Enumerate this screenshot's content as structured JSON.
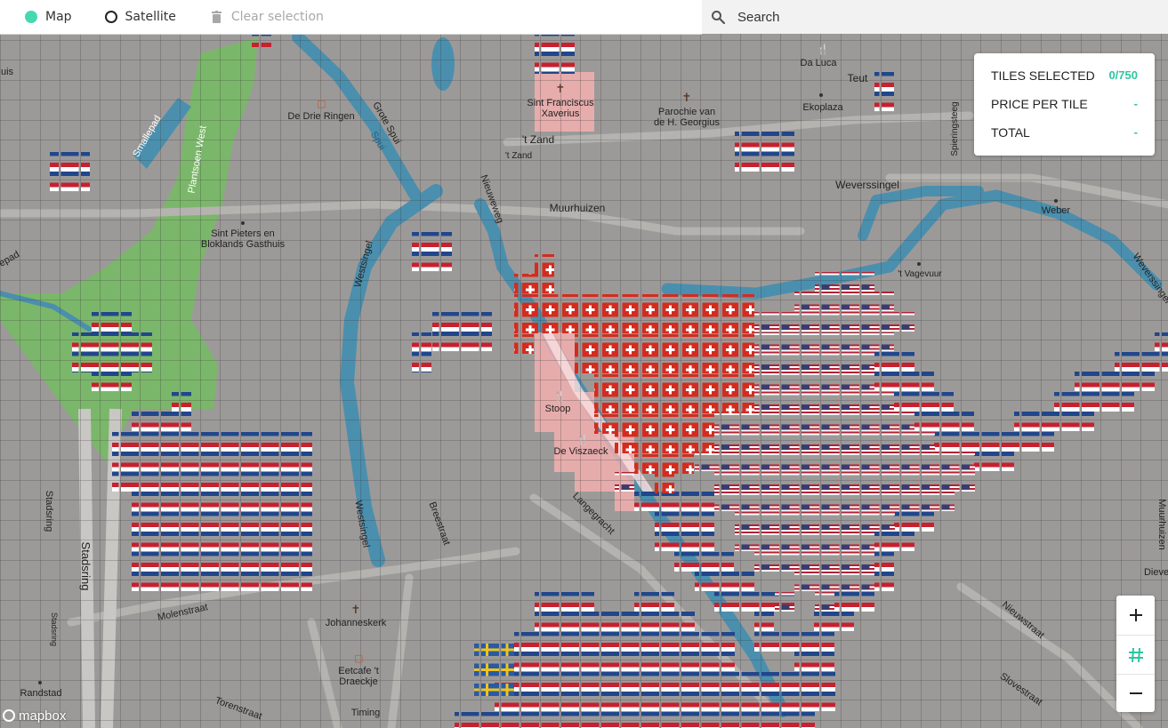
{
  "toolbar": {
    "map_label": "Map",
    "satellite_label": "Satellite",
    "clear_label": "Clear selection",
    "active_mode": "Map"
  },
  "search": {
    "placeholder": "Search"
  },
  "stats": {
    "tiles_selected_label": "TILES SELECTED",
    "tiles_selected_value": "0/750",
    "price_label": "PRICE PER TILE",
    "price_value": "-",
    "total_label": "TOTAL",
    "total_value": "-"
  },
  "zoom_controls": {
    "zoom_in": "+",
    "grid_toggle": "#",
    "zoom_out": "−"
  },
  "attribution": "mapbox",
  "colors": {
    "accent": "#45d9b0",
    "water": "#4b8fae",
    "park": "#7bb76a",
    "land": "#9b9a98",
    "selection": "#ffb3b3"
  },
  "map_labels": [
    {
      "text": "Da Luca"
    },
    {
      "text": "Teut"
    },
    {
      "text": "Ekoplaza"
    },
    {
      "text": "Sint Franciscus"
    },
    {
      "text": "Xaverius"
    },
    {
      "text": "Parochie van"
    },
    {
      "text": "de H. Georgius"
    },
    {
      "text": "De Drie Ringen"
    },
    {
      "text": "Grote Spui"
    },
    {
      "text": "Spui"
    },
    {
      "text": "'t Zand"
    },
    {
      "text": "'t Zand"
    },
    {
      "text": "Nieuweweg"
    },
    {
      "text": "Muurhuizen"
    },
    {
      "text": "Weverssingel"
    },
    {
      "text": "Weber"
    },
    {
      "text": "Spieringsteeg"
    },
    {
      "text": "Smallepad"
    },
    {
      "text": "Plantsoen West"
    },
    {
      "text": "Sint Pieters en"
    },
    {
      "text": "Bloklands Gasthuis"
    },
    {
      "text": "Westsingel"
    },
    {
      "text": "'t Vagevuur"
    },
    {
      "text": "Weverssingel"
    },
    {
      "text": "Stoop"
    },
    {
      "text": "De Viszaeck"
    },
    {
      "text": "Langegracht"
    },
    {
      "text": "Breestraat"
    },
    {
      "text": "Westsingel"
    },
    {
      "text": "Stadsring"
    },
    {
      "text": "Stadsring"
    },
    {
      "text": "Stadsring"
    },
    {
      "text": "Molenstraat"
    },
    {
      "text": "Johanneskerk"
    },
    {
      "text": "Eetcafe 't"
    },
    {
      "text": "Draeckje"
    },
    {
      "text": "Timing"
    },
    {
      "text": "Randstad"
    },
    {
      "text": "Torenstraat"
    },
    {
      "text": "Nieuwstraat"
    },
    {
      "text": "Slovestraat"
    },
    {
      "text": "Muurhuizen"
    },
    {
      "text": "Dieve"
    },
    {
      "text": "epad"
    },
    {
      "text": "uis"
    }
  ]
}
